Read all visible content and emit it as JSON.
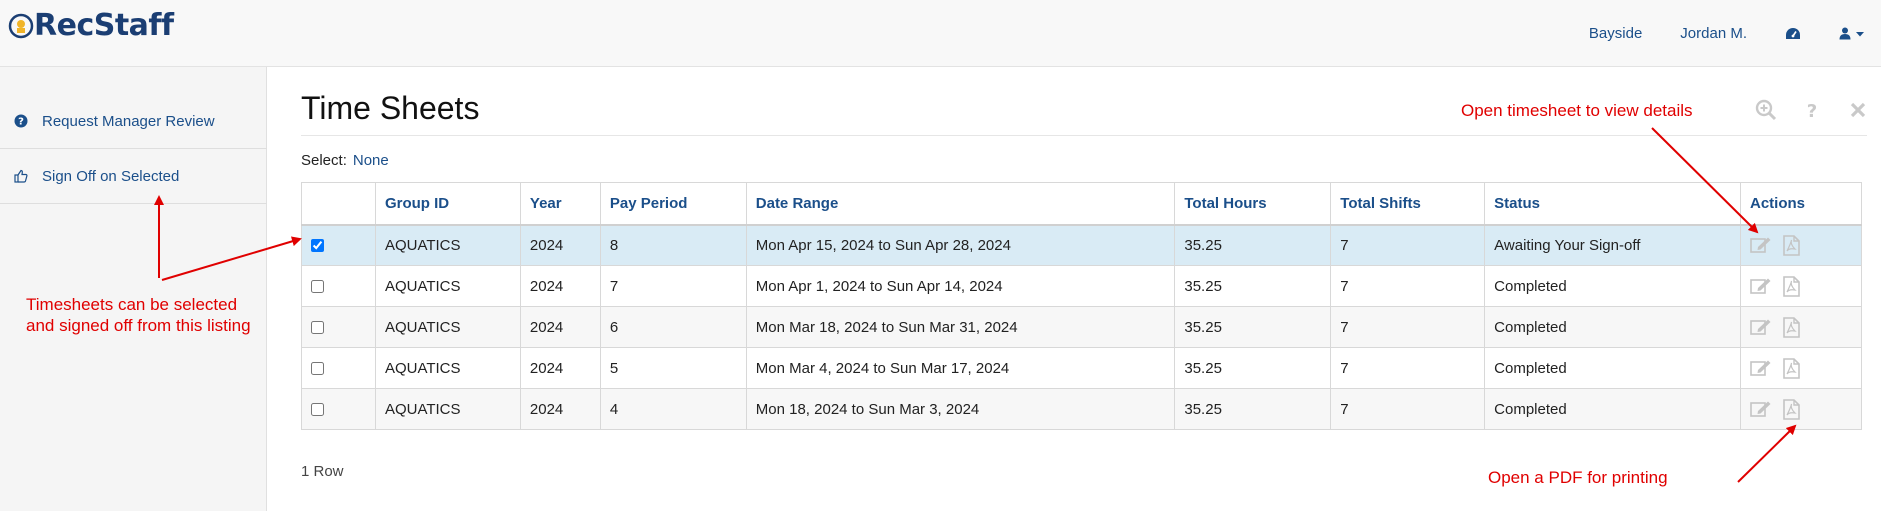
{
  "app": {
    "logo_text": "RecStaff"
  },
  "topnav": {
    "location": "Bayside",
    "user": "Jordan M."
  },
  "sidebar": {
    "items": [
      {
        "label": "Request Manager Review"
      },
      {
        "label": "Sign Off on Selected"
      }
    ]
  },
  "main": {
    "title": "Time Sheets",
    "select_label": "Select:",
    "select_none": "None",
    "footer": "1 Row"
  },
  "table": {
    "headers": [
      "Group ID",
      "Year",
      "Pay Period",
      "Date Range",
      "Total Hours",
      "Total Shifts",
      "Status",
      "Actions"
    ],
    "rows": [
      {
        "checked": true,
        "group": "AQUATICS",
        "year": "2024",
        "period": "8",
        "range": "Mon Apr 15, 2024 to Sun Apr 28, 2024",
        "hours": "35.25",
        "shifts": "7",
        "status": "Awaiting Your Sign-off"
      },
      {
        "checked": false,
        "group": "AQUATICS",
        "year": "2024",
        "period": "7",
        "range": "Mon Apr 1, 2024 to Sun Apr 14, 2024",
        "hours": "35.25",
        "shifts": "7",
        "status": "Completed"
      },
      {
        "checked": false,
        "group": "AQUATICS",
        "year": "2024",
        "period": "6",
        "range": "Mon Mar 18, 2024 to Sun Mar 31, 2024",
        "hours": "35.25",
        "shifts": "7",
        "status": "Completed"
      },
      {
        "checked": false,
        "group": "AQUATICS",
        "year": "2024",
        "period": "5",
        "range": "Mon Mar 4, 2024 to Sun Mar 17, 2024",
        "hours": "35.25",
        "shifts": "7",
        "status": "Completed"
      },
      {
        "checked": false,
        "group": "AQUATICS",
        "year": "2024",
        "period": "4",
        "range": "Mon 18, 2024 to Sun Mar 3, 2024",
        "hours": "35.25",
        "shifts": "7",
        "status": "Completed"
      }
    ]
  },
  "annotations": {
    "sidebar_note": "Timesheets can be selected and signed off from this listing",
    "view_note": "Open timesheet to view details",
    "pdf_note": "Open a PDF for printing"
  },
  "colors": {
    "accent": "#1b4f8a",
    "annotation": "#e00000",
    "selected_row": "#d9ebf5"
  },
  "icons": {
    "nav": [
      "dashboard-icon",
      "user-icon",
      "caret-down-icon"
    ],
    "sidebar": [
      "question-circle-icon",
      "thumbs-up-icon"
    ],
    "toolbar": [
      "zoom-icon",
      "help-icon",
      "close-icon"
    ],
    "row_actions": [
      "edit-icon",
      "pdf-icon"
    ]
  }
}
